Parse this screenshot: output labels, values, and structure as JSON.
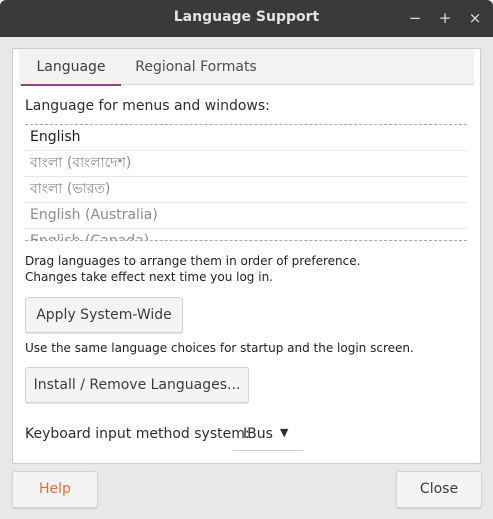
{
  "window": {
    "title": "Language Support"
  },
  "window_controls": {
    "minimize": "−",
    "maximize": "+",
    "close": "×"
  },
  "tabs": [
    {
      "label": "Language",
      "active": true
    },
    {
      "label": "Regional Formats",
      "active": false
    }
  ],
  "language_section": {
    "label": "Language for menus and windows:",
    "items": [
      "English",
      "বাংলা (বাংলাদেশ)",
      "বাংলা (ভারত)",
      "English (Australia)",
      "English (Canada)"
    ],
    "hint_line1": "Drag languages to arrange them in order of preference.",
    "hint_line2": "Changes take effect next time you log in."
  },
  "apply_button": {
    "label": "Apply System-Wide"
  },
  "apply_hint": "Use the same language choices for startup and the login screen.",
  "install_button": {
    "label": "Install / Remove Languages..."
  },
  "keyboard": {
    "label": "Keyboard input method system:",
    "value": "IBus",
    "arrow": "▼"
  },
  "footer": {
    "help_label": "Help",
    "close_label": "Close"
  },
  "colors": {
    "accent": "#9b3c88",
    "help_text": "#d9733a",
    "titlebar": "#3a3a3a"
  }
}
